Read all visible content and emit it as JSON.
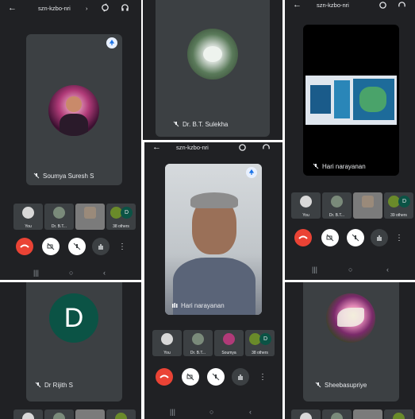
{
  "meeting_code": "szn-kzbo-nri",
  "panels": {
    "p1": {
      "main_name": "Soumya Suresh S",
      "thumbs": [
        "You",
        "Dr. B.T...",
        "",
        "38 others"
      ],
      "thumb_count_letter": "D"
    },
    "p2": {
      "main_name": "Dr. B.T. Sulekha"
    },
    "p3": {
      "main_name": "Hari narayanan",
      "thumbs": [
        "You",
        "Dr. B.T...",
        "",
        "39 others"
      ],
      "thumb_count_letter": "D"
    },
    "p4": {
      "main_name": "Hari narayanan",
      "thumbs": [
        "You",
        "Dr. B.T...",
        "Soumya",
        "38 others"
      ],
      "thumb_count_letter": "D"
    },
    "p5": {
      "main_name": "Dr Rijith S",
      "avatar_letter": "D"
    },
    "p6": {
      "main_name": "Sheebasupriye"
    }
  },
  "colors": {
    "panel_bg": "#202124",
    "tile_bg": "#3c4043",
    "end_call": "#ea4335",
    "avatar_green": "#0b5345",
    "pin_blue": "#1a73e8"
  },
  "icons": {
    "back": "arrow-left-icon",
    "camera_switch": "camera-switch-icon",
    "audio": "headphones-icon",
    "mic_off": "mic-off-icon",
    "pin": "pin-icon"
  }
}
